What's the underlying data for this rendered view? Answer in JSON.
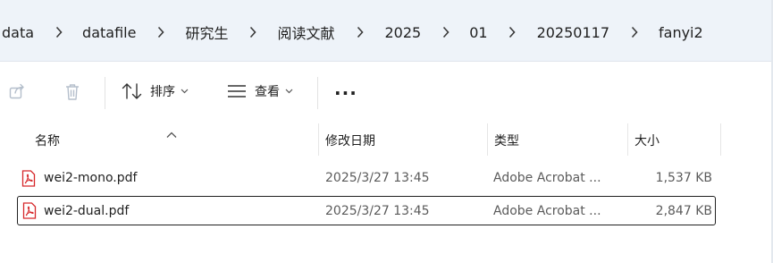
{
  "breadcrumb": [
    "data",
    "datafile",
    "研究生",
    "阅读文献",
    "2025",
    "01",
    "20250117",
    "fanyi2"
  ],
  "toolbar": {
    "sort_label": "排序",
    "view_label": "查看",
    "more_label": "···"
  },
  "columns": {
    "name": "名称",
    "modified": "修改日期",
    "type": "类型",
    "size": "大小"
  },
  "files": [
    {
      "name": "wei2-mono.pdf",
      "modified": "2025/3/27 13:45",
      "type": "Adobe Acrobat ...",
      "size": "1,537 KB",
      "selected": false
    },
    {
      "name": "wei2-dual.pdf",
      "modified": "2025/3/27 13:45",
      "type": "Adobe Acrobat ...",
      "size": "2,847 KB",
      "selected": true
    }
  ],
  "colors": {
    "pdf_icon": "#d6282b"
  }
}
